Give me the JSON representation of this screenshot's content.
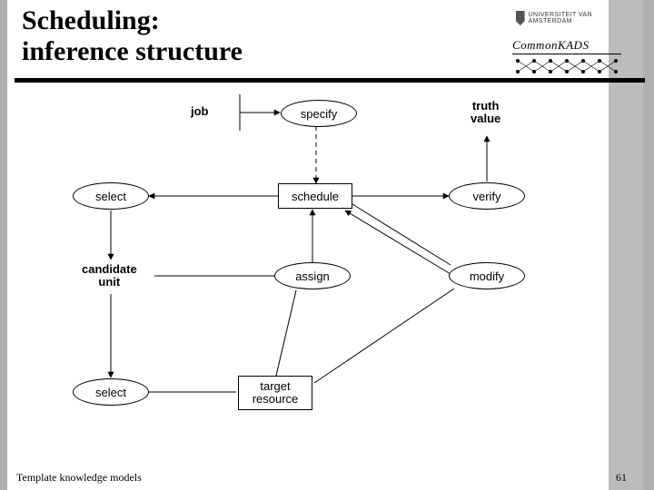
{
  "header": {
    "title_line1": "Scheduling:",
    "title_line2": "inference structure"
  },
  "logos": {
    "uva_text": "UNIVERSITEIT VAN AMSTERDAM",
    "commonkads": "CommonKADS"
  },
  "footer": {
    "left": "Template knowledge models",
    "pagenum": "61"
  },
  "diagram": {
    "labels": {
      "job": "job",
      "truth_value_l1": "truth",
      "truth_value_l2": "value",
      "candidate_unit_l1": "candidate",
      "candidate_unit_l2": "unit"
    },
    "ovals": {
      "specify": "specify",
      "select_top": "select",
      "verify": "verify",
      "assign": "assign",
      "modify": "modify",
      "select_bottom": "select"
    },
    "rects": {
      "schedule": "schedule",
      "target_resource_l1": "target",
      "target_resource_l2": "resource"
    }
  }
}
